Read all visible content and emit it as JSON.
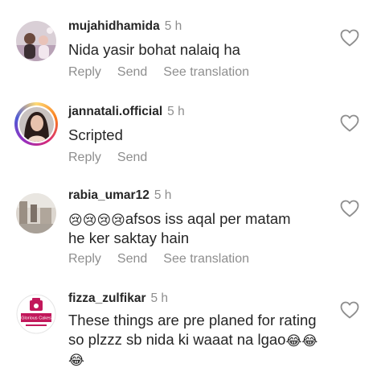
{
  "comments": [
    {
      "username": "mujahidhamida",
      "time": "5 h",
      "text": "Nida yasir bohat nalaiq ha",
      "actions": [
        "Reply",
        "Send",
        "See translation"
      ]
    },
    {
      "username": "jannatali.official",
      "time": "5 h",
      "text": "Scripted",
      "actions": [
        "Reply",
        "Send"
      ]
    },
    {
      "username": "rabia_umar12",
      "time": "5 h",
      "text_emojis": "😢😢😢😢",
      "text_line1": "afsos iss aqal per matam",
      "text_line2": "he ker saktay hain",
      "actions": [
        "Reply",
        "Send",
        "See translation"
      ]
    },
    {
      "username": "fizza_zulfikar",
      "time": "5 h",
      "avatar_text": "Glorious Cakes",
      "text_line1": "These things are pre planed for rating",
      "text_line2": "so plzzz sb nida ki waaat na lgao",
      "text_line2_emojis": "😂😂",
      "text_line3_emojis": "😂"
    }
  ],
  "icons": {
    "like": "heart-outline-icon"
  },
  "colors": {
    "secondary_text": "#8e8e8e",
    "primary_text": "#262626",
    "avatar_brand": "#c2185b"
  }
}
